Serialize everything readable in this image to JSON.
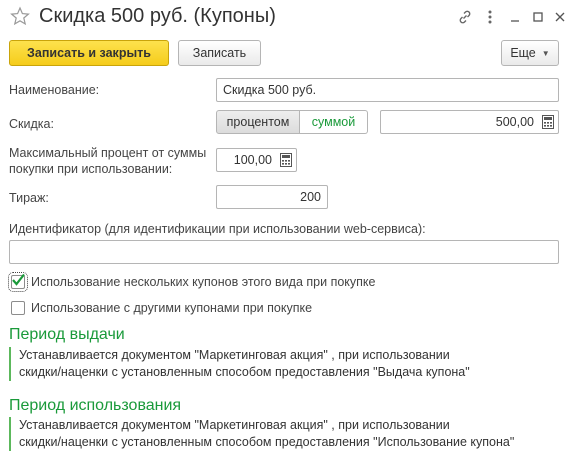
{
  "window": {
    "title": "Скидка 500 руб. (Купоны)",
    "icons": [
      "star-icon",
      "link-icon",
      "more-vertical-icon",
      "minimize-icon",
      "maximize-icon",
      "close-icon"
    ]
  },
  "toolbar": {
    "save_close_label": "Записать и закрыть",
    "save_label": "Записать",
    "more_label": "Еще"
  },
  "form": {
    "name_label": "Наименование:",
    "name_value": "Скидка 500 руб.",
    "discount_label": "Скидка:",
    "discount_percent_option": "процентом",
    "discount_sum_option": "суммой",
    "discount_value": "500,00",
    "max_percent_label_line1": "Максимальный процент от суммы",
    "max_percent_label_line2": "покупки при использовании:",
    "max_percent_value": "100,00",
    "circulation_label": "Тираж:",
    "circulation_value": "200",
    "identifier_label": "Идентификатор (для идентификации при использовании web-сервиса):",
    "identifier_value": "",
    "multiple_coupons_label": "Использование нескольких купонов этого вида при покупке",
    "multiple_coupons_checked": true,
    "other_coupons_label": "Использование с другими купонами при покупке",
    "other_coupons_checked": false
  },
  "issue_period": {
    "title": "Период выдачи",
    "line1": "Устанавливается документом \"Маркетинговая акция\" , при использовании",
    "line2": "скидки/наценки с установленным способом предоставления \"Выдача купона\""
  },
  "usage_period": {
    "title": "Период использования",
    "line1": "Устанавливается документом \"Маркетинговая акция\" , при использовании",
    "line2": "скидки/наценки с установленным способом предоставления \"Использование купона\""
  },
  "colors": {
    "accent_green": "#1a9a3a",
    "primary_button": "#f5cc1b"
  }
}
